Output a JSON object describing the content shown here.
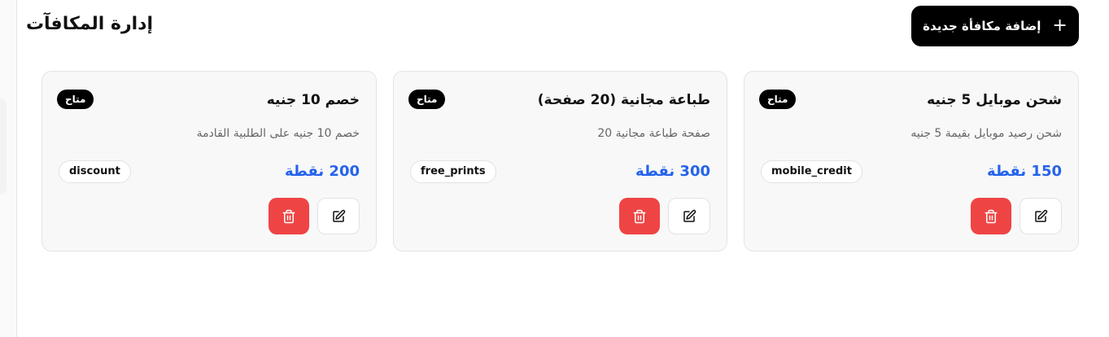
{
  "header": {
    "title": "إدارة المكافآت",
    "add_button_label": "إضافة مكافأة جديدة",
    "add_button_icon": "+"
  },
  "rewards": [
    {
      "title": "شحن موبايل 5 جنيه",
      "description": "شحن رصيد موبايل بقيمة 5 جنيه",
      "status": "متاح",
      "points": "150 نقطة",
      "type": "mobile_credit"
    },
    {
      "title": "طباعة مجانية (20 صفحة)",
      "description": "صفحة طباعة مجانية 20",
      "status": "متاح",
      "points": "300 نقطة",
      "type": "free_prints"
    },
    {
      "title": "خصم 10 جنيه",
      "description": "خصم 10 جنيه على الطلبية القادمة",
      "status": "متاح",
      "points": "200 نقطة",
      "type": "discount"
    }
  ],
  "colors": {
    "accent": "#2563eb",
    "delete": "#ef4444",
    "primary": "#000000"
  },
  "icons": {
    "edit": "pencil-square-icon",
    "delete": "trash-icon",
    "add": "plus-icon"
  }
}
